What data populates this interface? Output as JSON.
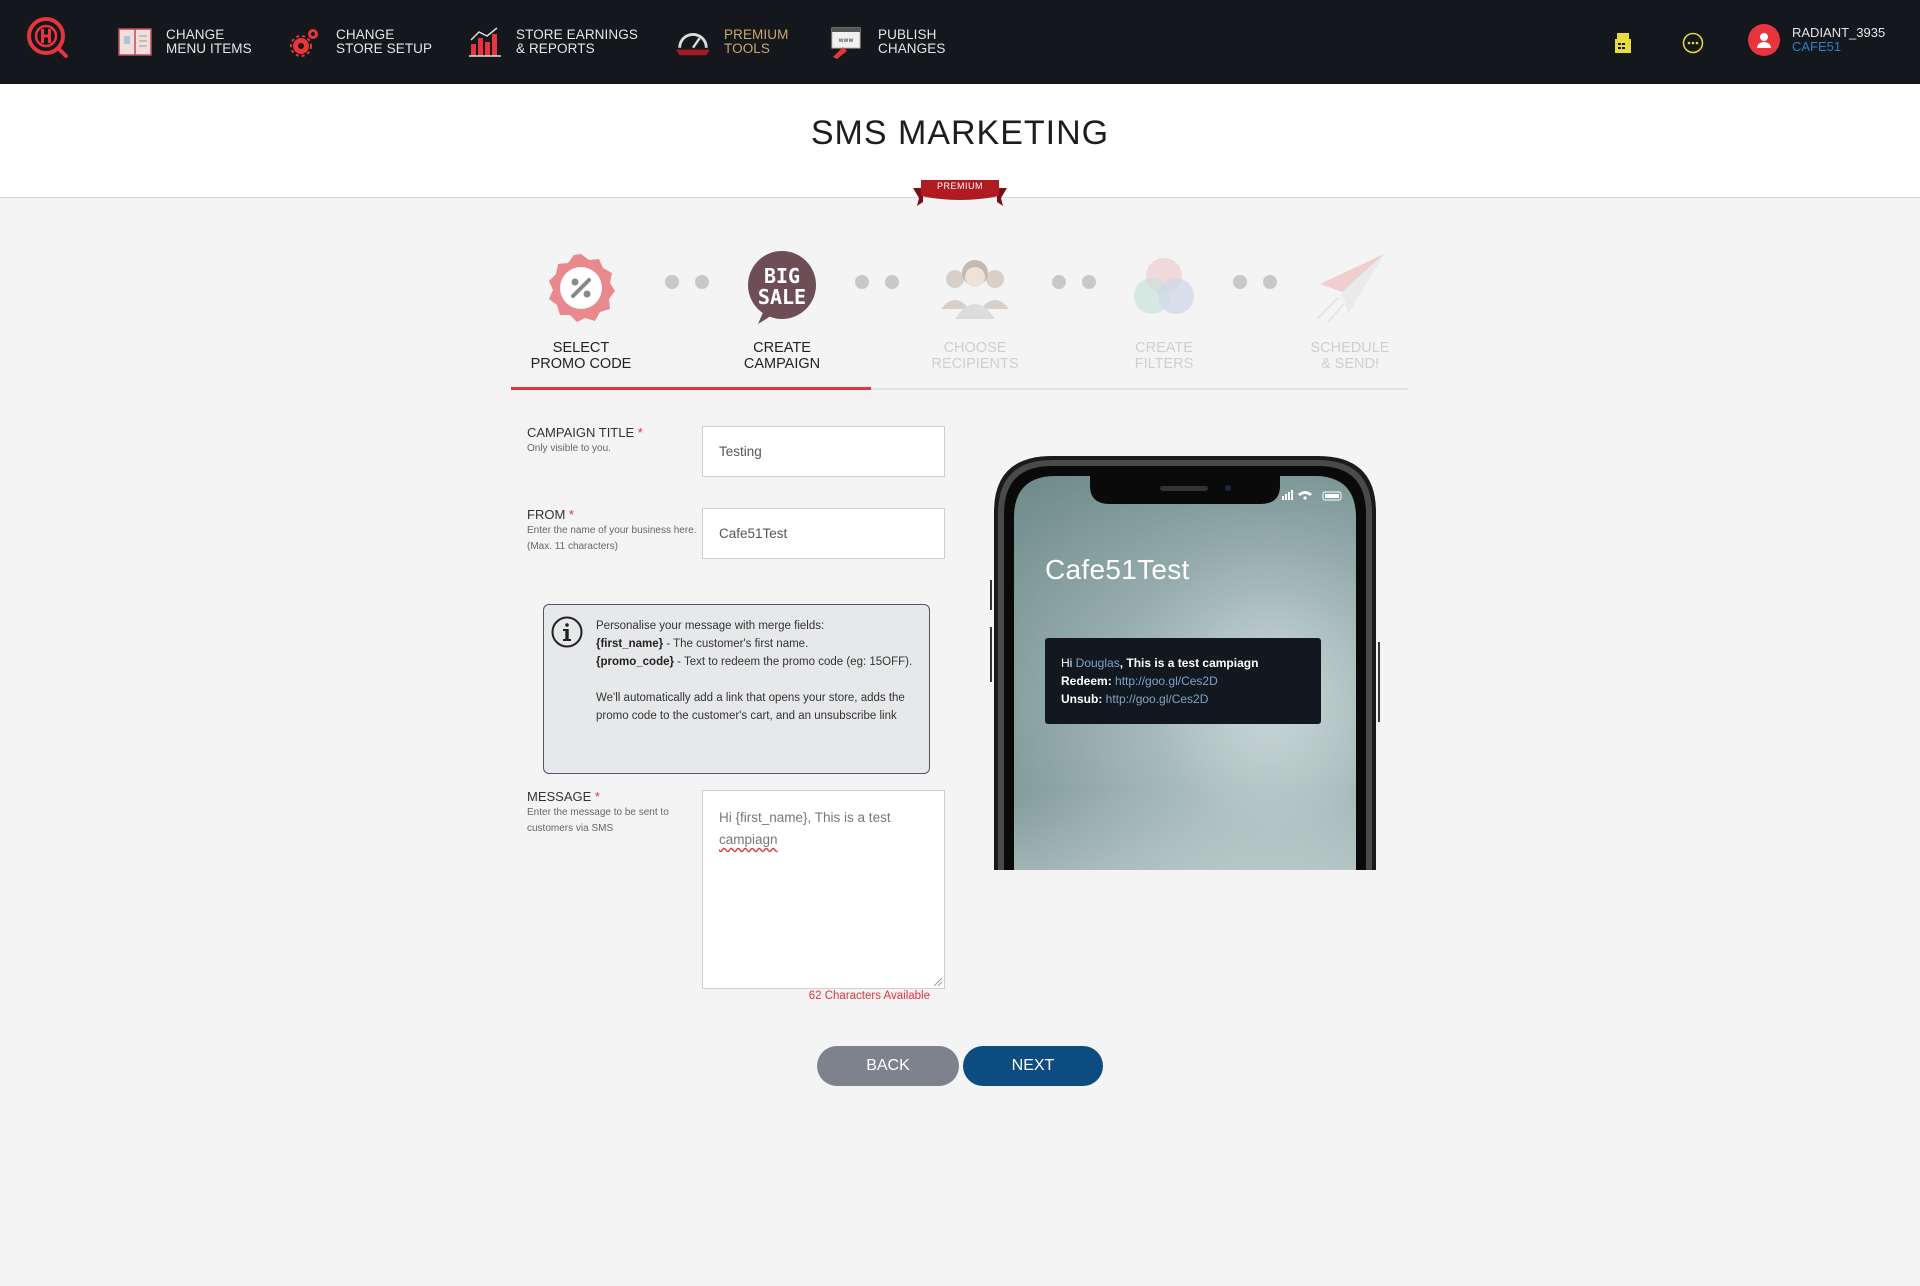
{
  "nav": {
    "items": [
      {
        "line1": "CHANGE",
        "line2": "MENU ITEMS",
        "icon": "menu-book-icon"
      },
      {
        "line1": "CHANGE",
        "line2": "STORE SETUP",
        "icon": "gears-icon"
      },
      {
        "line1": "STORE EARNINGS",
        "line2": "& REPORTS",
        "icon": "bar-chart-icon"
      },
      {
        "line1": "PREMIUM",
        "line2": "TOOLS",
        "icon": "speedometer-icon"
      },
      {
        "line1": "PUBLISH",
        "line2": "CHANGES",
        "icon": "publish-www-icon"
      }
    ],
    "user": {
      "name": "RADIANT_3935",
      "store": "CAFE51"
    }
  },
  "page": {
    "title": "SMS MARKETING",
    "premium_label": "PREMIUM"
  },
  "steps": [
    {
      "line1": "SELECT",
      "line2": "PROMO CODE",
      "state": "done"
    },
    {
      "line1": "CREATE",
      "line2": "CAMPAIGN",
      "state": "active",
      "badge_line1": "BIG",
      "badge_line2": "SALE"
    },
    {
      "line1": "CHOOSE",
      "line2": "RECIPIENTS",
      "state": "disabled"
    },
    {
      "line1": "CREATE",
      "line2": "FILTERS",
      "state": "disabled"
    },
    {
      "line1": "SCHEDULE",
      "line2": "& SEND!",
      "state": "disabled"
    }
  ],
  "form": {
    "campaign_title": {
      "label": "CAMPAIGN TITLE",
      "required": "*",
      "help": "Only visible to you.",
      "value": "Testing"
    },
    "from": {
      "label": "FROM",
      "required": "*",
      "help": "Enter the name of your business here. (Max. 11 characters)",
      "value": "Cafe51Test"
    },
    "info": {
      "intro": "Personalise your message with merge fields:",
      "field1_key": "{first_name}",
      "field1_desc": " - The customer's first name.",
      "field2_key": "{promo_code}",
      "field2_desc": " - Text to redeem the promo code (eg: 15OFF).",
      "note": "We'll automatically add a link that opens your store, adds the promo code to the customer's cart, and an unsubscribe link"
    },
    "message": {
      "label": "MESSAGE",
      "required": "*",
      "help": "Enter the message to be sent to customers via SMS",
      "value_part1": "Hi {first_name}, This is a test ",
      "value_part2": "campiagn"
    },
    "char_count": "62 Characters Available"
  },
  "buttons": {
    "back": "BACK",
    "next": "NEXT"
  },
  "preview": {
    "sender": "Cafe51Test",
    "hi": "Hi ",
    "name": "Douglas",
    "body": ", This is a test campiagn",
    "redeem_label": "Redeem: ",
    "redeem_url": "http://goo.gl/Ces2D",
    "unsub_label": "Unsub: ",
    "unsub_url": "http://goo.gl/Ces2D"
  },
  "colors": {
    "accent": "#d9363e",
    "primary": "#0d4c80",
    "back": "#7d828c",
    "nav_bg": "#14171b",
    "user_store": "#2c7fd0"
  }
}
